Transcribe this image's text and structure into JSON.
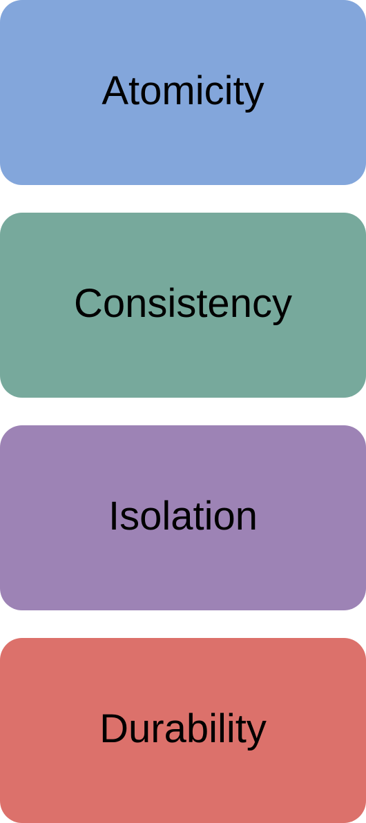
{
  "boxes": [
    {
      "label": "Atomicity",
      "color": "#83a6db"
    },
    {
      "label": "Consistency",
      "color": "#77a99c"
    },
    {
      "label": "Isolation",
      "color": "#9d83b5"
    },
    {
      "label": "Durability",
      "color": "#dc716b"
    }
  ]
}
